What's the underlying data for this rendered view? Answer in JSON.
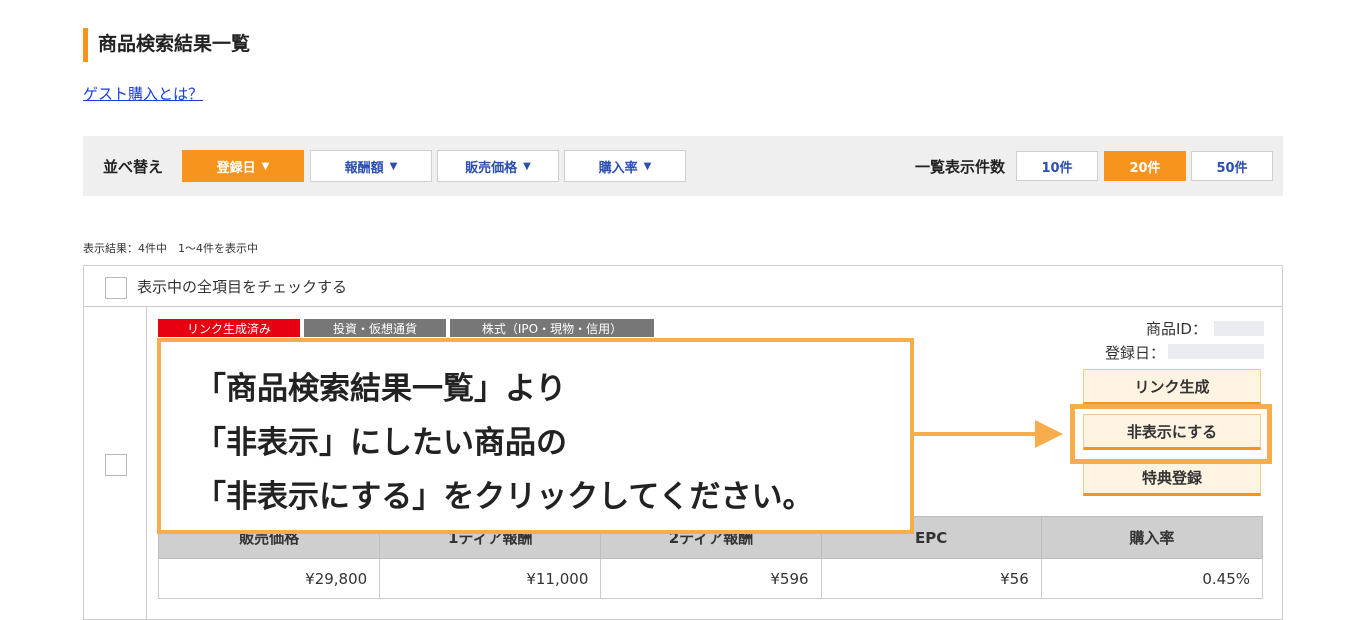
{
  "page": {
    "title": "商品検索結果一覧",
    "guest_link": "ゲスト購入とは？"
  },
  "sort": {
    "label": "並べ替え",
    "options": [
      {
        "label": "登録日",
        "active": true
      },
      {
        "label": "報酬額",
        "active": false
      },
      {
        "label": "販売価格",
        "active": false
      },
      {
        "label": "購入率",
        "active": false
      }
    ],
    "caret": "▼"
  },
  "display_count": {
    "label": "一覧表示件数",
    "options": [
      {
        "label": "10件",
        "active": false
      },
      {
        "label": "20件",
        "active": true
      },
      {
        "label": "50件",
        "active": false
      }
    ]
  },
  "result_text": "表示結果：4件中　1～4件を表示中",
  "check_all_label": "表示中の全項目をチェックする",
  "item": {
    "tags": [
      "リンク生成済み",
      "投資・仮想通貨",
      "株式（IPO・現物・信用）"
    ],
    "product_id_label": "商品ID：",
    "registered_label": "登録日：",
    "buttons": [
      "リンク生成",
      "非表示にする",
      "特典登録"
    ],
    "table": {
      "headers": [
        "販売価格",
        "1ティア報酬",
        "2ティア報酬",
        "EPC",
        "購入率"
      ],
      "values": [
        "¥29,800",
        "¥11,000",
        "¥596",
        "¥56",
        "0.45%"
      ]
    }
  },
  "callout": {
    "lines": [
      "「商品検索結果一覧」より",
      "「非表示」にしたい商品の",
      "「非表示にする」をクリックしてください。"
    ]
  },
  "colors": {
    "accent": "#f7941d",
    "callout_border": "#f8ad4c",
    "tag_red": "#e60012",
    "tag_gray": "#777777",
    "link": "#1a3ddb"
  }
}
